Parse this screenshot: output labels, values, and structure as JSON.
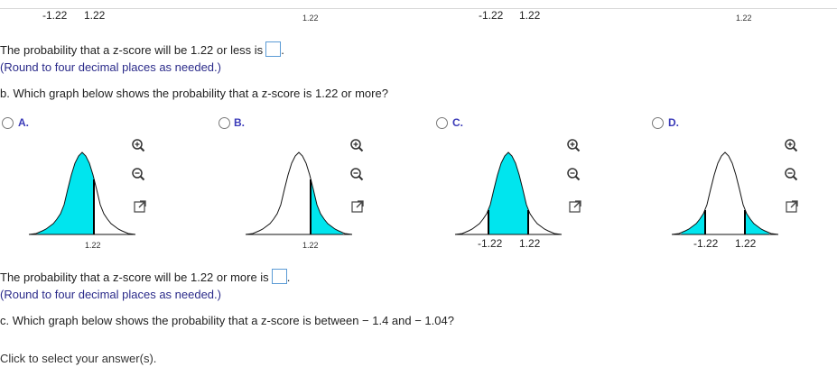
{
  "top_row": {
    "labels": [
      "-1.22",
      "1.22",
      "1.22",
      "-1.22",
      "1.22",
      "1.22"
    ]
  },
  "part_a": {
    "answer_text": "The probability that a z-score will be 1.22 or less is",
    "answer_suffix": ".",
    "round_note": "(Round to four decimal places as needed.)"
  },
  "part_b": {
    "question": "b. Which graph below shows the probability that a z-score is 1.22 or more?",
    "options": [
      {
        "letter": "A.",
        "ticks": [
          "1.22"
        ]
      },
      {
        "letter": "B.",
        "ticks": [
          "1.22"
        ]
      },
      {
        "letter": "C.",
        "ticks": [
          "-1.22",
          "1.22"
        ]
      },
      {
        "letter": "D.",
        "ticks": [
          "-1.22",
          "1.22"
        ]
      }
    ],
    "answer_text": "The probability that a z-score will be 1.22 or more is",
    "answer_suffix": ".",
    "round_note": "(Round to four decimal places as needed.)"
  },
  "part_c": {
    "question": "c. Which graph below shows the probability that a z-score is between  − 1.4 and  − 1.04?"
  },
  "footer": {
    "hint": "Click to select your answer(s)."
  },
  "colors": {
    "fill": "#00e5ee",
    "link": "#3a3ab8",
    "input_border": "#5b9bd5"
  },
  "icons": [
    "zoom-in-icon",
    "zoom-out-icon",
    "external-link-icon"
  ]
}
